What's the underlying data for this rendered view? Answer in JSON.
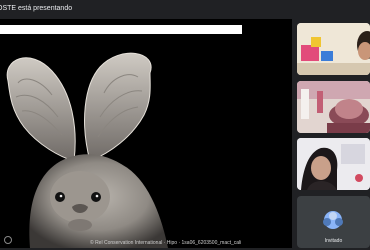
{
  "header": {
    "presenter_text": "OSTE está presentando"
  },
  "presentation": {
    "credit_text": "© Rel Conservation International · Hipo · 1sa06_6203500_mact_cali"
  },
  "participants": [
    {
      "name": "",
      "tile": "video"
    },
    {
      "name": "",
      "tile": "video"
    },
    {
      "name": "",
      "tile": "video"
    },
    {
      "name": "Invitado",
      "tile": "avatar"
    }
  ],
  "colors": {
    "background": "#202124",
    "stage": "#000000",
    "text": "#e8eaed"
  }
}
